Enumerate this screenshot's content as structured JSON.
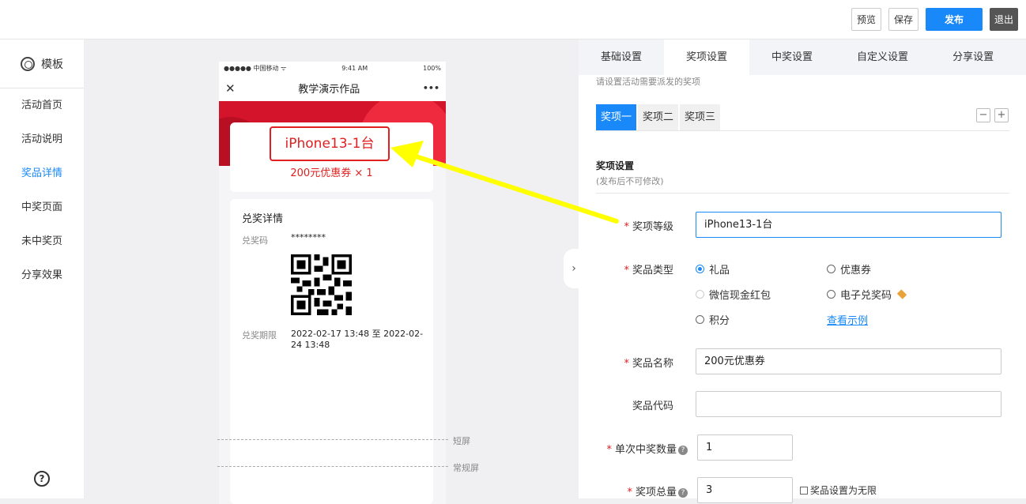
{
  "toolbar": {
    "preview": "预览",
    "save": "保存",
    "publish": "发布",
    "exit": "退出"
  },
  "sidebar": {
    "template_label": "模板",
    "items": [
      {
        "label": "活动首页",
        "active": false
      },
      {
        "label": "活动说明",
        "active": false
      },
      {
        "label": "奖品详情",
        "active": true
      },
      {
        "label": "中奖页面",
        "active": false
      },
      {
        "label": "未中奖页",
        "active": false
      },
      {
        "label": "分享效果",
        "active": false
      }
    ],
    "help": "?"
  },
  "phone": {
    "carrier": "●●●●● 中国移动 ᯤ",
    "time": "9:41 AM",
    "battery": "100%",
    "nav_title": "教学演示作品",
    "close": "✕",
    "more": "•••",
    "prize_level": "iPhone13-1台",
    "prize_sub": "200元优惠券 × 1",
    "detail_title": "兑奖详情",
    "code_label": "兑奖码",
    "code_value": "********",
    "period_label": "兑奖期限",
    "period_value": "2022-02-17 13:48 至 2022-02-24 13:48",
    "short_screen": "短屏",
    "normal_screen": "常规屏"
  },
  "panel": {
    "tabs": [
      "基础设置",
      "奖项设置",
      "中奖设置",
      "自定义设置",
      "分享设置"
    ],
    "active_tab": 1,
    "hint": "请设置活动需要派发的奖项",
    "prize_tabs": [
      "奖项一",
      "奖项二",
      "奖项三"
    ],
    "minus": "−",
    "plus": "+",
    "section_title": "奖项设置",
    "section_sub": "(发布后不可修改)",
    "fields": {
      "level_label": "奖项等级",
      "level_value": "iPhone13-1台",
      "type_label": "奖品类型",
      "type_options": [
        "礼品",
        "优惠券",
        "微信现金红包",
        "电子兑奖码",
        "积分"
      ],
      "example_link": "查看示例",
      "name_label": "奖品名称",
      "name_value": "200元优惠券",
      "code_label": "奖品代码",
      "code_value": "",
      "qty_label": "单次中奖数量",
      "qty_value": "1",
      "total_label": "奖项总量",
      "total_value": "3",
      "unlimited_label": "奖品设置为无限"
    }
  },
  "colors": {
    "accent": "#1989fa",
    "red": "#e02020",
    "arrow": "#ffff00"
  }
}
